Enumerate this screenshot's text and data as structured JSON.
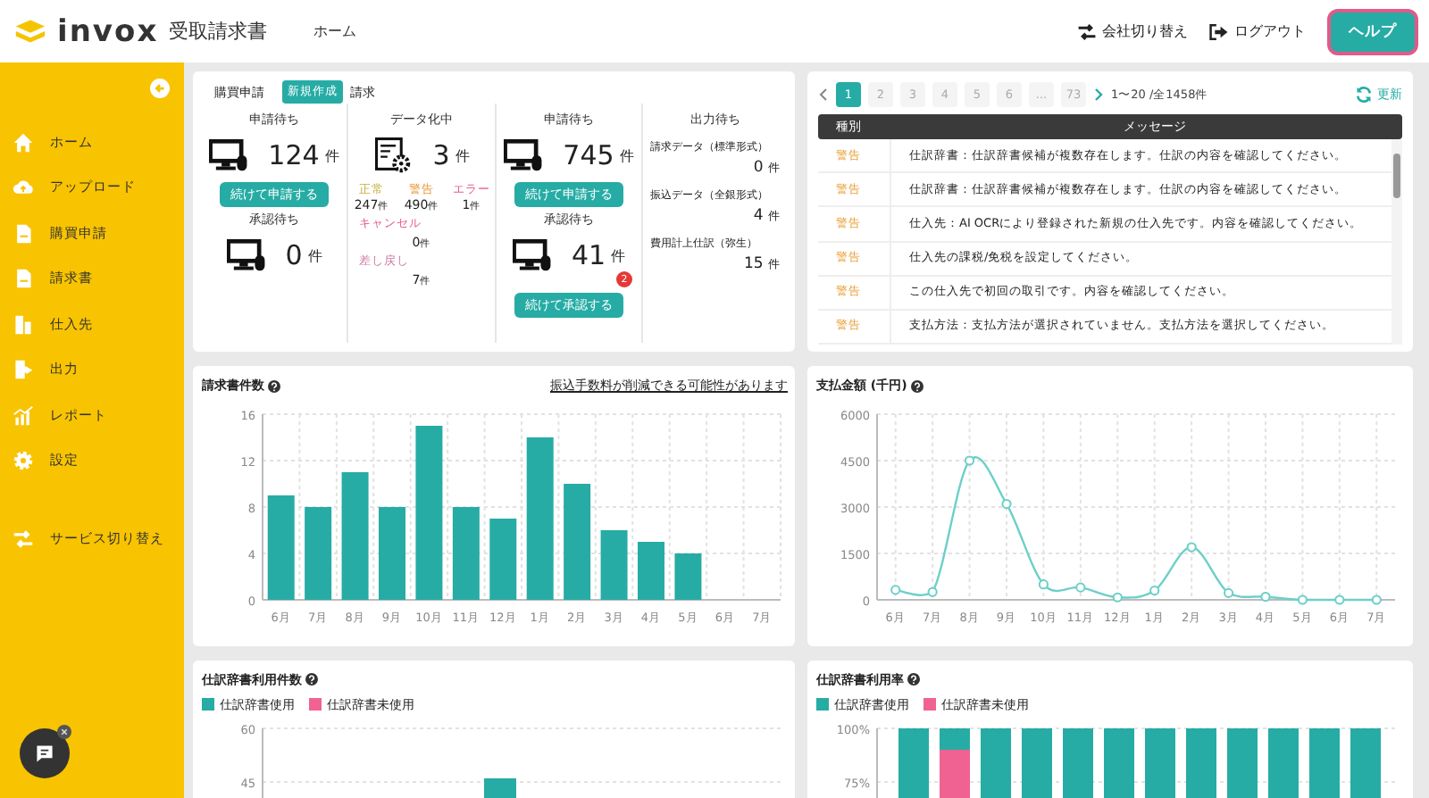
{
  "header": {
    "logo_word": "invox",
    "product": "受取請求書",
    "nav": "ホーム",
    "actions": [
      {
        "kind": "switch",
        "label": "会社切り替え"
      },
      {
        "kind": "logout",
        "label": "ログアウト"
      }
    ],
    "help_button": "ヘルプ"
  },
  "sidebar": {
    "items": [
      {
        "kind": "home",
        "label": "ホーム"
      },
      {
        "kind": "upload",
        "label": "アップロード"
      },
      {
        "kind": "doc",
        "label": "購買申請"
      },
      {
        "kind": "doc",
        "label": "請求書"
      },
      {
        "kind": "supplier",
        "label": "仕入先"
      },
      {
        "kind": "output",
        "label": "出力"
      },
      {
        "kind": "report",
        "label": "レポート"
      },
      {
        "kind": "settings",
        "label": "設定"
      }
    ],
    "service_switch": "サービス切り替え"
  },
  "summary": {
    "purchase_label": "購買申請",
    "new_button": "新規作成",
    "invoice_label": "請求",
    "purchase": {
      "pending": {
        "title": "申請待ち",
        "count": "124",
        "unit": "件",
        "button": "続けて申請する"
      },
      "approval": {
        "title": "承認待ち",
        "count": "0",
        "unit": "件"
      }
    },
    "digitizing": {
      "title": "データ化中",
      "count": "3",
      "unit": "件",
      "statuses": [
        {
          "label": "正常",
          "color": "#c4ae3c",
          "count": "247",
          "unit": "件"
        },
        {
          "label": "警告",
          "color": "#e89a3c",
          "count": "490",
          "unit": "件"
        },
        {
          "label": "エラー",
          "color": "#e8608a",
          "count": "1",
          "unit": "件"
        }
      ],
      "others": [
        {
          "label": "キャンセル",
          "color": "#e8608a",
          "count": "0",
          "unit": "件"
        },
        {
          "label": "差し戻し",
          "color": "#d07aa0",
          "count": "7",
          "unit": "件"
        }
      ]
    },
    "invoice": {
      "pending": {
        "title": "申請待ち",
        "count": "745",
        "unit": "件",
        "button": "続けて申請する"
      },
      "approval": {
        "title": "承認待ち",
        "count": "41",
        "unit": "件",
        "button": "続けて承認する",
        "badge": "2"
      }
    },
    "output": {
      "title": "出力待ち",
      "items": [
        {
          "label": "請求データ（標準形式）",
          "count": "0",
          "unit": "件"
        },
        {
          "label": "振込データ（全銀形式）",
          "count": "4",
          "unit": "件"
        },
        {
          "label": "費用計上仕訳（弥生）",
          "count": "15",
          "unit": "件"
        }
      ]
    }
  },
  "messages": {
    "pager": {
      "pages": [
        {
          "label": "1",
          "selected": true
        },
        {
          "label": "2",
          "selected": false
        },
        {
          "label": "3",
          "selected": false
        },
        {
          "label": "4",
          "selected": false
        },
        {
          "label": "5",
          "selected": false
        },
        {
          "label": "6",
          "selected": false
        },
        {
          "label": "...",
          "selected": false
        },
        {
          "label": "73",
          "selected": false
        }
      ],
      "range": "1〜20 /全1458件",
      "refresh": "更新"
    },
    "columns": [
      "種別",
      "メッセージ"
    ],
    "rows": [
      {
        "kind": "warning",
        "type": "警告",
        "message": "仕訳辞書：仕訳辞書候補が複数存在します。仕訳の内容を確認してください。"
      },
      {
        "kind": "warning",
        "type": "警告",
        "message": "仕訳辞書：仕訳辞書候補が複数存在します。仕訳の内容を確認してください。"
      },
      {
        "kind": "warning",
        "type": "警告",
        "message": "仕入先：AI OCRにより登録された新規の仕入先です。内容を確認してください。"
      },
      {
        "kind": "warning",
        "type": "警告",
        "message": "仕入先の課税/免税を設定してください。"
      },
      {
        "kind": "warning",
        "type": "警告",
        "message": "この仕入先で初回の取引です。内容を確認してください。"
      },
      {
        "kind": "warning",
        "type": "警告",
        "message": "支払方法：支払方法が選択されていません。支払方法を選択してください。"
      }
    ]
  },
  "invoice_count_chart": {
    "title": "請求書件数",
    "link": "振込手数料が削減できる可能性があります",
    "chart_data": {
      "type": "bar",
      "categories": [
        "6月",
        "7月",
        "8月",
        "9月",
        "10月",
        "11月",
        "12月",
        "1月",
        "2月",
        "3月",
        "4月",
        "5月",
        "6月",
        "7月"
      ],
      "series": [
        {
          "color": "#26aca5",
          "values": [
            9,
            8,
            11,
            8,
            15,
            8,
            7,
            14,
            10,
            6,
            5,
            4,
            0,
            0
          ]
        }
      ],
      "ylim": [
        0,
        16
      ],
      "yticks": [
        0,
        4,
        8,
        12,
        16
      ],
      "grid": true
    }
  },
  "payment_chart": {
    "title": "支払金額 (千円)",
    "chart_data": {
      "type": "line",
      "categories": [
        "6月",
        "7月",
        "8月",
        "9月",
        "10月",
        "11月",
        "12月",
        "1月",
        "2月",
        "3月",
        "4月",
        "5月",
        "6月",
        "7月"
      ],
      "series": [
        {
          "color": "#6ccfc9",
          "marker": true,
          "values": [
            320,
            250,
            4500,
            3100,
            500,
            400,
            80,
            300,
            1700,
            220,
            100,
            0,
            0,
            0
          ]
        }
      ],
      "ylim": [
        0,
        6000
      ],
      "yticks": [
        0,
        1500,
        3000,
        4500,
        6000
      ],
      "grid": true
    }
  },
  "dictionary_count_chart": {
    "title": "仕訳辞書利用件数",
    "legend": [
      {
        "label": "仕訳辞書使用",
        "color": "#26aca5"
      },
      {
        "label": "仕訳辞書未使用",
        "color": "#f06292"
      }
    ],
    "y_tick_labels": [
      "60",
      "45"
    ]
  },
  "dictionary_rate_chart": {
    "title": "仕訳辞書利用率",
    "legend": [
      {
        "label": "仕訳辞書使用",
        "color": "#26aca5"
      },
      {
        "label": "仕訳辞書未使用",
        "color": "#f06292"
      }
    ],
    "y_tick_labels": [
      "100%",
      "75%"
    ]
  }
}
